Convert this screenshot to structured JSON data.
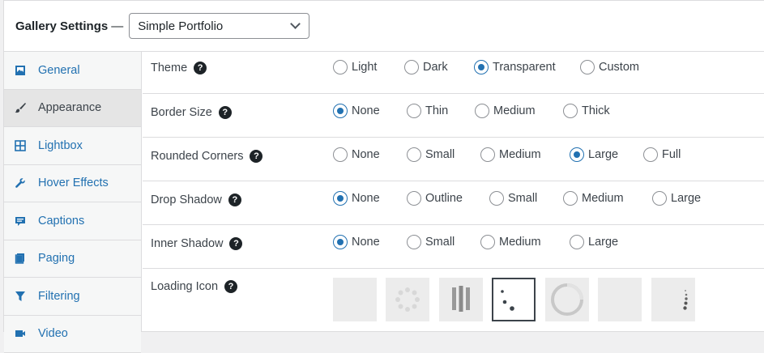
{
  "header": {
    "title": "Gallery Settings",
    "dash": "—",
    "template_select": "Simple Portfolio"
  },
  "sidebar": {
    "items": [
      {
        "label": "General",
        "icon": "image-icon",
        "active": false
      },
      {
        "label": "Appearance",
        "icon": "brush-icon",
        "active": true
      },
      {
        "label": "Lightbox",
        "icon": "grid-icon",
        "active": false
      },
      {
        "label": "Hover Effects",
        "icon": "wrench-icon",
        "active": false
      },
      {
        "label": "Captions",
        "icon": "caption-icon",
        "active": false
      },
      {
        "label": "Paging",
        "icon": "pages-icon",
        "active": false
      },
      {
        "label": "Filtering",
        "icon": "filter-icon",
        "active": false
      },
      {
        "label": "Video",
        "icon": "video-icon",
        "active": false
      }
    ]
  },
  "settings": {
    "theme": {
      "label": "Theme",
      "options": [
        "Light",
        "Dark",
        "Transparent",
        "Custom"
      ],
      "selected": "Transparent"
    },
    "border_size": {
      "label": "Border Size",
      "options": [
        "None",
        "Thin",
        "Medium",
        "Thick"
      ],
      "selected": "None"
    },
    "rounded_corners": {
      "label": "Rounded Corners",
      "options": [
        "None",
        "Small",
        "Medium",
        "Large",
        "Full"
      ],
      "selected": "Large"
    },
    "drop_shadow": {
      "label": "Drop Shadow",
      "options": [
        "None",
        "Outline",
        "Small",
        "Medium",
        "Large"
      ],
      "selected": "None"
    },
    "inner_shadow": {
      "label": "Inner Shadow",
      "options": [
        "None",
        "Small",
        "Medium",
        "Large"
      ],
      "selected": "None"
    },
    "loading_icon": {
      "label": "Loading Icon",
      "options": [
        "none-icon",
        "dots-circle-icon",
        "bars-icon",
        "trail-dots-icon",
        "ring-icon",
        "blank-icon",
        "vertical-dots-icon"
      ],
      "selected": "trail-dots-icon"
    }
  },
  "help_glyph": "?",
  "colors": {
    "accent": "#2271b1",
    "link": "#2271b1"
  }
}
